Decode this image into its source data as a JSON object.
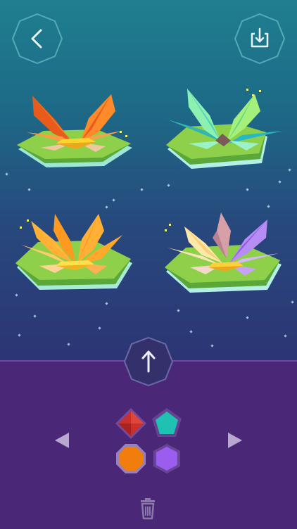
{
  "header": {
    "back_icon": "chevron-left-icon",
    "download_icon": "tray-download-icon"
  },
  "flowers": [
    {
      "name": "orange-lily",
      "petal": "#ff8a2a",
      "petal_dark": "#e85b1b",
      "accent": "#ffd32e",
      "pad": "#8fd04a"
    },
    {
      "name": "teal-lily",
      "petal": "#79e6a7",
      "petal_dark": "#2fb7b0",
      "accent": "#7b5a5a",
      "pad": "#8fd04a"
    },
    {
      "name": "amber-lily",
      "petal": "#ffb035",
      "petal_dark": "#ff8a1a",
      "accent": "#ffe04a",
      "pad": "#8fd04a"
    },
    {
      "name": "violet-lily",
      "petal": "#b88cf5",
      "petal_dark": "#8c57e6",
      "accent": "#ffcf3a",
      "pad": "#8fd04a"
    }
  ],
  "colors": {
    "sky_top": "#1f7f8f",
    "sky_bottom": "#2c3575",
    "tray": "#4b2778",
    "swatch_red": "#c8302c",
    "swatch_teal": "#1fc2b2",
    "swatch_orange": "#f07d0c",
    "swatch_purple": "#9b5cf0"
  },
  "controls": {
    "up_icon": "arrow-up-icon",
    "prev_icon": "triangle-left-icon",
    "next_icon": "triangle-right-icon",
    "delete_icon": "trash-icon",
    "swatches": [
      "red",
      "teal",
      "orange",
      "purple"
    ]
  }
}
